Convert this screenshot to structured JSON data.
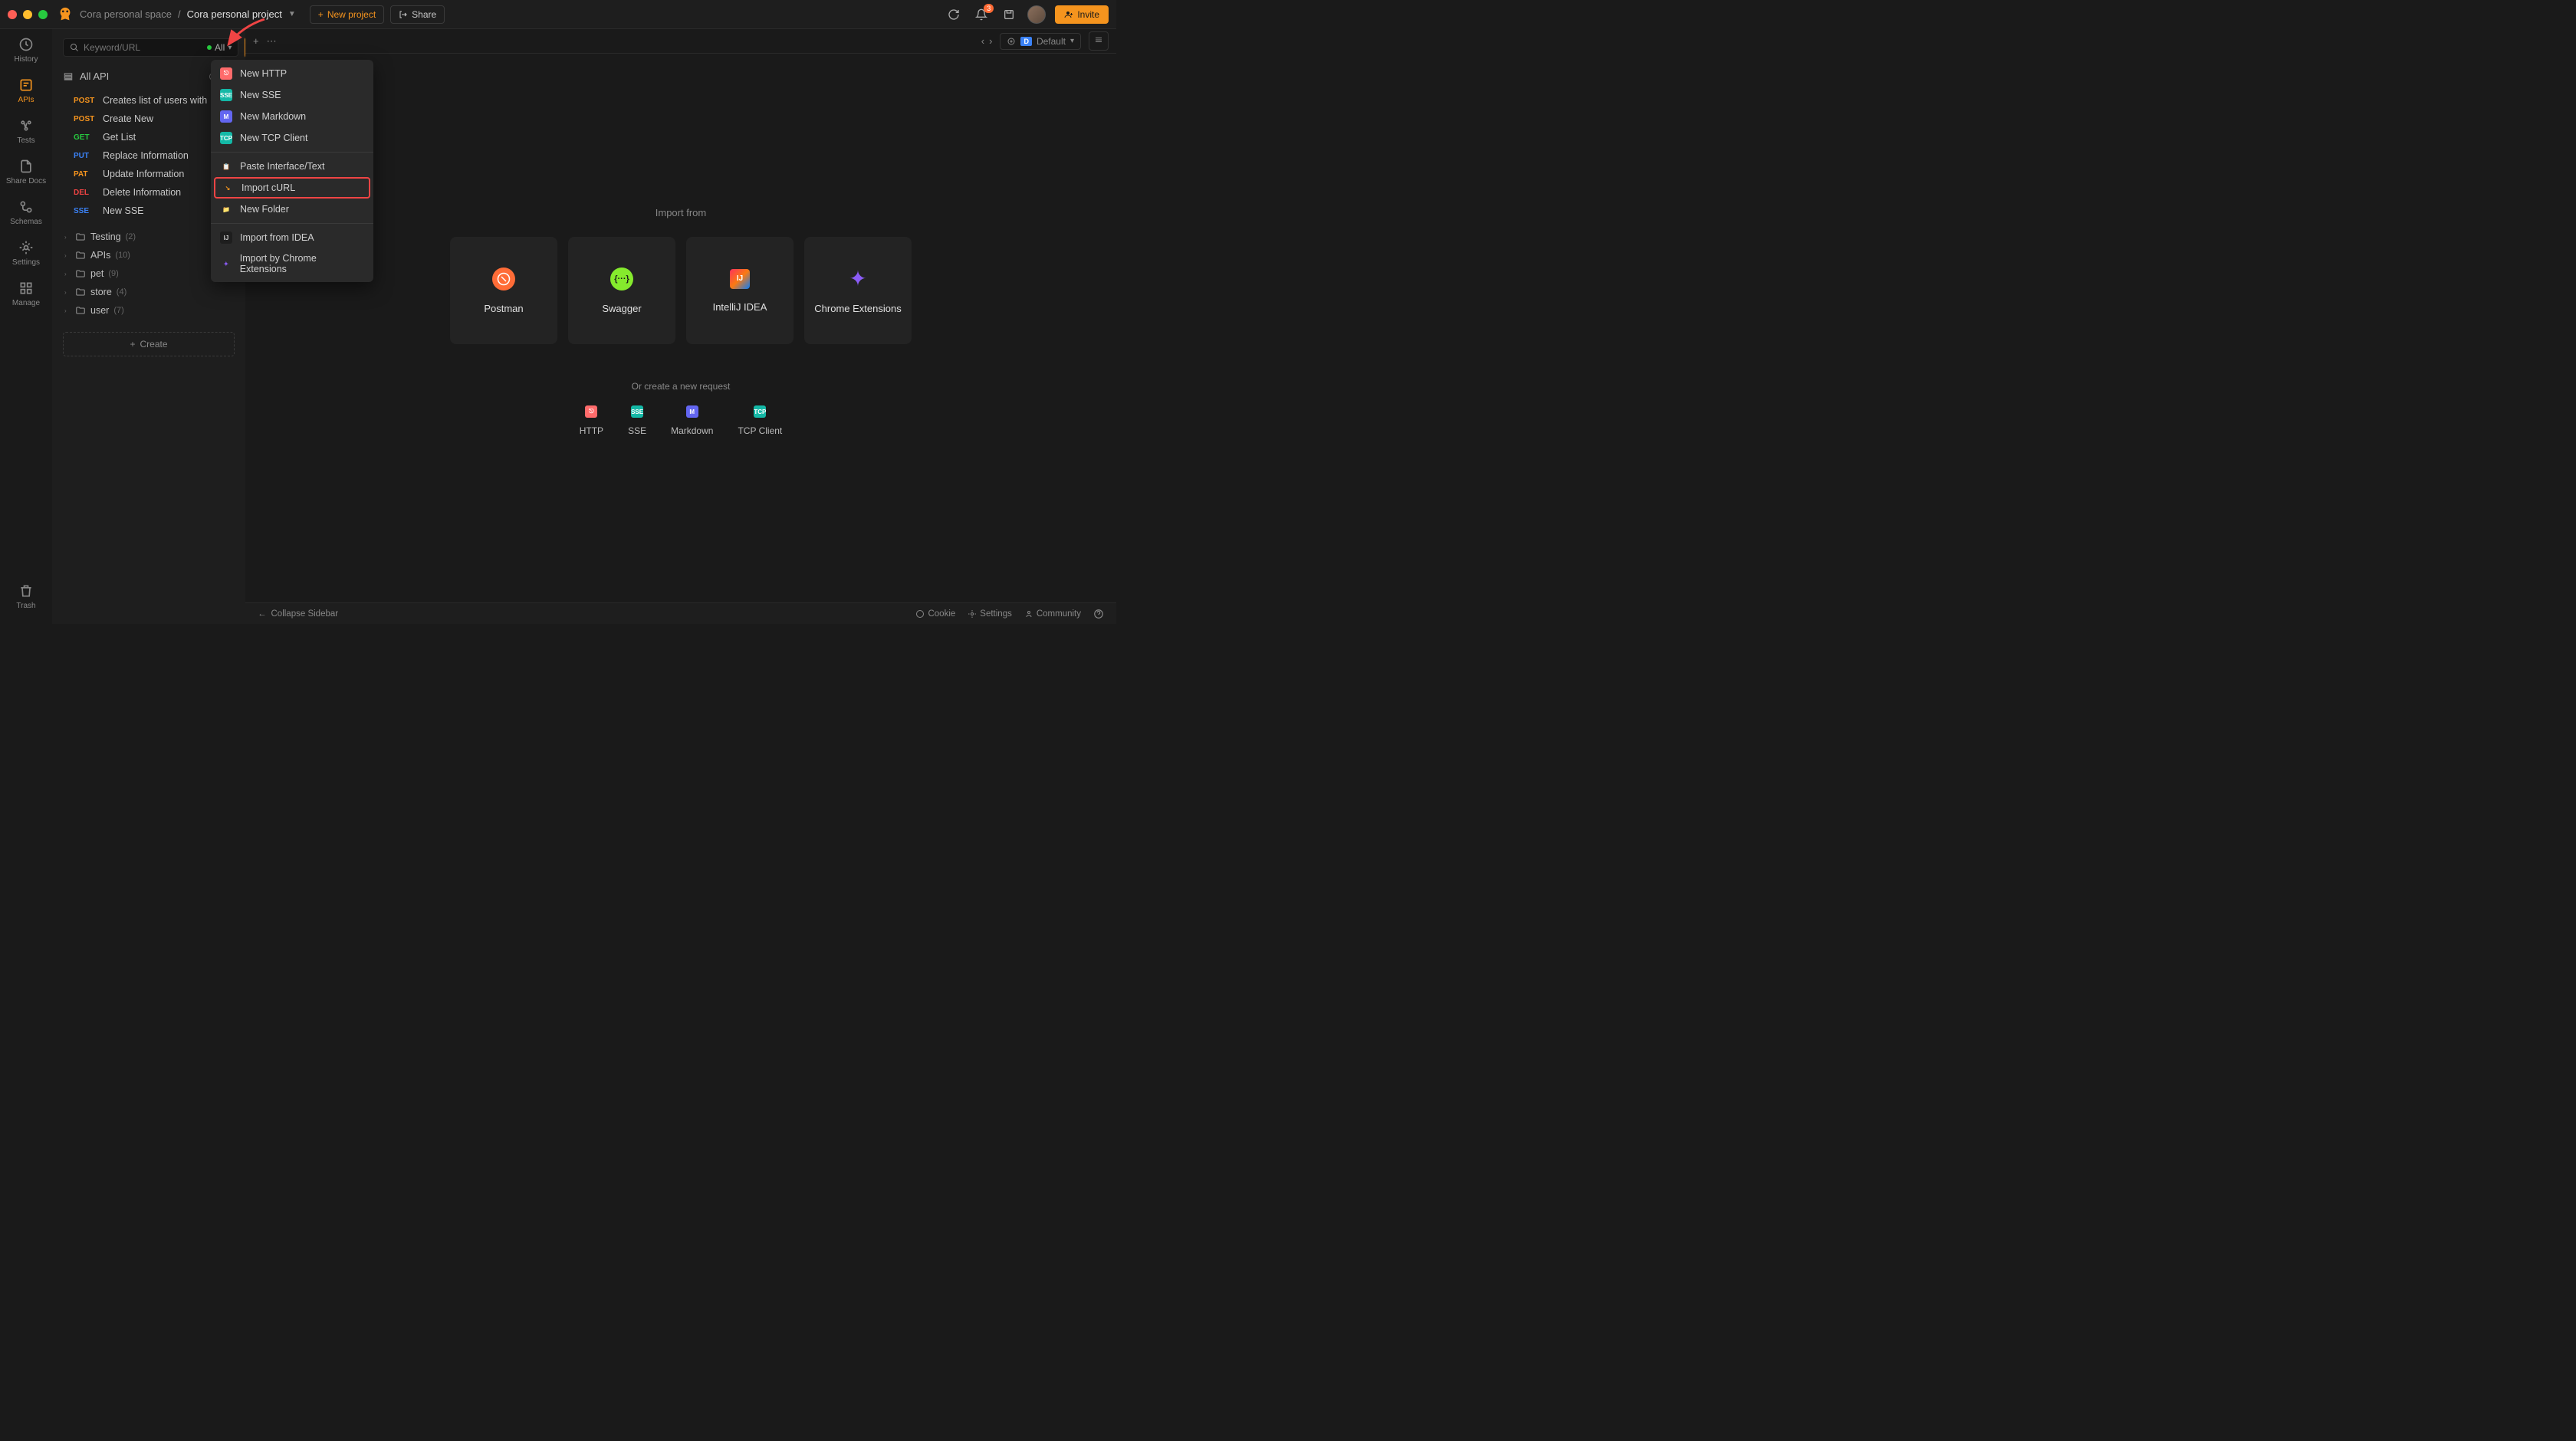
{
  "topbar": {
    "workspace": "Cora personal space",
    "project": "Cora personal project",
    "new_project": "New project",
    "share": "Share",
    "notification_count": "3",
    "invite": "Invite"
  },
  "rail": {
    "history": "History",
    "apis": "APIs",
    "tests": "Tests",
    "share_docs": "Share Docs",
    "schemas": "Schemas",
    "settings": "Settings",
    "manage": "Manage",
    "trash": "Trash"
  },
  "sidebar": {
    "search_placeholder": "Keyword/URL",
    "filter_label": "All",
    "all_api": "All API",
    "create": "Create",
    "apis": [
      {
        "method": "POST",
        "class": "m-post",
        "name": "Creates list of users with"
      },
      {
        "method": "POST",
        "class": "m-post",
        "name": "Create New"
      },
      {
        "method": "GET",
        "class": "m-get",
        "name": "Get List"
      },
      {
        "method": "PUT",
        "class": "m-put",
        "name": "Replace Information"
      },
      {
        "method": "PAT",
        "class": "m-pat",
        "name": "Update Information"
      },
      {
        "method": "DEL",
        "class": "m-del",
        "name": "Delete Information"
      },
      {
        "method": "SSE",
        "class": "m-sse",
        "name": "New SSE"
      }
    ],
    "folders": [
      {
        "name": "Testing",
        "count": "(2)"
      },
      {
        "name": "APIs",
        "count": "(10)"
      },
      {
        "name": "pet",
        "count": "(9)"
      },
      {
        "name": "store",
        "count": "(4)"
      },
      {
        "name": "user",
        "count": "(7)"
      }
    ]
  },
  "dropdown": {
    "items_a": [
      {
        "label": "New HTTP",
        "icon": "ic-http",
        "glyph": "⎋"
      },
      {
        "label": "New SSE",
        "icon": "ic-sse",
        "glyph": "SSE"
      },
      {
        "label": "New Markdown",
        "icon": "ic-md",
        "glyph": "M"
      },
      {
        "label": "New TCP Client",
        "icon": "ic-tcp",
        "glyph": "TCP"
      }
    ],
    "items_b": [
      {
        "label": "Paste Interface/Text",
        "icon": "ic-paste",
        "glyph": "📋"
      },
      {
        "label": "Import cURL",
        "icon": "ic-curl",
        "glyph": "↘",
        "highlighted": true
      },
      {
        "label": "New Folder",
        "icon": "ic-folder",
        "glyph": "📁"
      }
    ],
    "items_c": [
      {
        "label": "Import from IDEA",
        "icon": "ic-idea",
        "glyph": "IJ"
      },
      {
        "label": "Import by Chrome Extensions",
        "icon": "ic-ext",
        "glyph": "✦"
      }
    ]
  },
  "tabbar": {
    "env_label": "Default",
    "env_badge": "D"
  },
  "main": {
    "import_from": "Import from",
    "cards": [
      {
        "label": "Postman",
        "bg": "#ff6c37",
        "glyph": "◐"
      },
      {
        "label": "Swagger",
        "bg": "#85ea2d",
        "glyph": "{···}"
      },
      {
        "label": "IntelliJ IDEA",
        "bg": "#1a1a1a",
        "glyph": "IJ"
      },
      {
        "label": "Chrome Extensions",
        "bg": "transparent",
        "glyph": "✦"
      }
    ],
    "or_create": "Or create a new request",
    "create_items": [
      {
        "label": "HTTP",
        "icon": "ic-http",
        "glyph": "⎋"
      },
      {
        "label": "SSE",
        "icon": "ic-sse",
        "glyph": "SSE"
      },
      {
        "label": "Markdown",
        "icon": "ic-md",
        "glyph": "M"
      },
      {
        "label": "TCP Client",
        "icon": "ic-tcp",
        "glyph": "TCP"
      }
    ]
  },
  "bottombar": {
    "collapse": "Collapse Sidebar",
    "cookie": "Cookie",
    "settings": "Settings",
    "community": "Community"
  }
}
